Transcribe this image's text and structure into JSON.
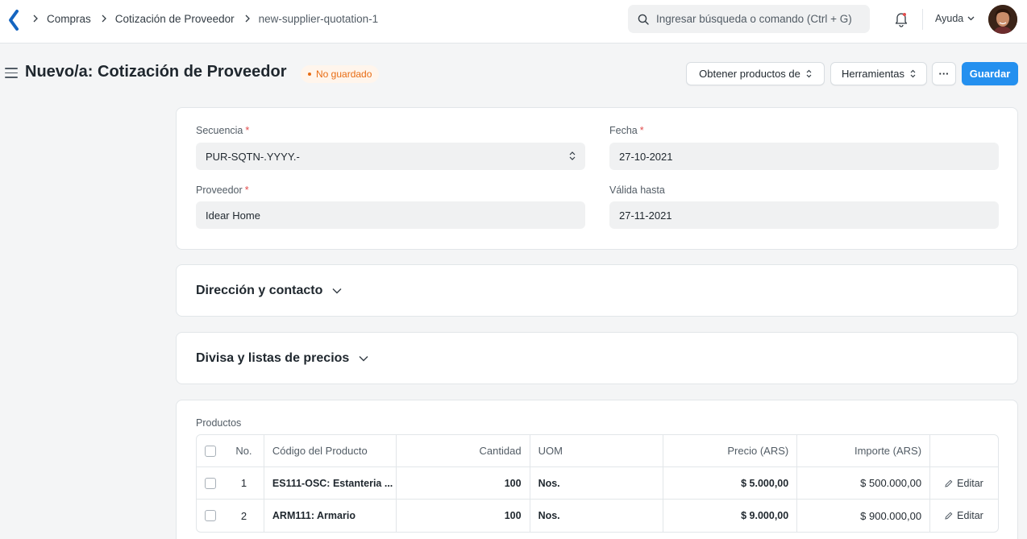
{
  "navbar": {
    "breadcrumbs": [
      "Compras",
      "Cotización de Proveedor",
      "new-supplier-quotation-1"
    ],
    "search_placeholder": "Ingresar búsqueda o comando (Ctrl + G)",
    "help_label": "Ayuda"
  },
  "page": {
    "title": "Nuevo/a: Cotización de Proveedor",
    "status": "No guardado",
    "actions": {
      "get_items": "Obtener productos de",
      "tools": "Herramientas",
      "more": "···",
      "save": "Guardar"
    }
  },
  "form": {
    "series_label": "Secuencia",
    "series_value": "PUR-SQTN-.YYYY.-",
    "date_label": "Fecha",
    "date_value": "27-10-2021",
    "supplier_label": "Proveedor",
    "supplier_value": "Idear Home",
    "valid_till_label": "Válida hasta",
    "valid_till_value": "27-11-2021",
    "required_mark": "*"
  },
  "sections": {
    "address_contact": "Dirección y contacto",
    "currency_price_list": "Divisa y listas de precios"
  },
  "items": {
    "label": "Productos",
    "columns": {
      "no": "No.",
      "item_code": "Código del Producto",
      "qty": "Cantidad",
      "uom": "UOM",
      "rate": "Precio (ARS)",
      "amount": "Importe (ARS)"
    },
    "edit_label": "Editar",
    "rows": [
      {
        "no": "1",
        "item_code": "ES111-OSC: Estanteria ...",
        "qty": "100",
        "uom": "Nos.",
        "rate": "$ 5.000,00",
        "amount": "$ 500.000,00"
      },
      {
        "no": "2",
        "item_code": "ARM111: Armario",
        "qty": "100",
        "uom": "Nos.",
        "rate": "$ 9.000,00",
        "amount": "$ 900.000,00"
      }
    ]
  },
  "colors": {
    "primary": "#2490ef",
    "not_saved": "#e86c13",
    "required": "#e24c4c"
  }
}
